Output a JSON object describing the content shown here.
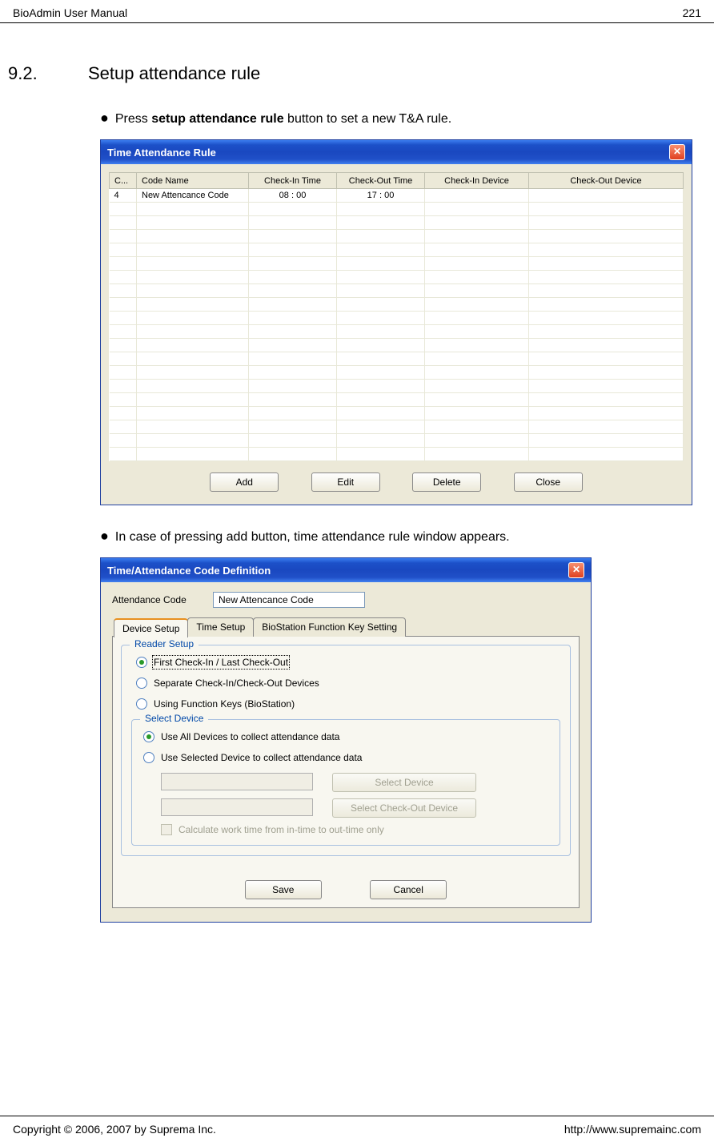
{
  "header": {
    "left": "BioAdmin User Manual",
    "page_num": "221"
  },
  "section": {
    "number": "9.2.",
    "title": "Setup attendance rule"
  },
  "bullets": {
    "b1_prefix": "Press ",
    "b1_bold": "setup attendance rule",
    "b1_suffix": " button to set a new T&A rule.",
    "b2": "In case of pressing add button, time attendance rule window appears."
  },
  "win1": {
    "title": "Time Attendance Rule",
    "cols": [
      "C...",
      "Code Name",
      "Check-In Time",
      "Check-Out Time",
      "Check-In Device",
      "Check-Out Device"
    ],
    "rows": [
      {
        "c": "4",
        "name": "New Attencance Code",
        "in": "08 : 00",
        "out": "17 : 00",
        "ind": "",
        "outd": ""
      }
    ],
    "buttons": {
      "add": "Add",
      "edit": "Edit",
      "del": "Delete",
      "close": "Close"
    }
  },
  "win2": {
    "title": "Time/Attendance Code Definition",
    "attendance_code_label": "Attendance Code",
    "attendance_code_value": "New Attencance Code",
    "tabs": {
      "t1": "Device Setup",
      "t2": "Time Setup",
      "t3": "BioStation Function Key Setting"
    },
    "reader_setup": {
      "legend": "Reader Setup",
      "r1": "First Check-In / Last Check-Out",
      "r2": "Separate Check-In/Check-Out Devices",
      "r3": "Using Function Keys (BioStation)"
    },
    "select_device": {
      "legend": "Select Device",
      "r1": "Use All Devices to collect attendance data",
      "r2": "Use Selected Device to collect attendance data",
      "btn1": "Select Device",
      "btn2": "Select Check-Out Device",
      "chk": "Calculate work time from in-time to out-time only"
    },
    "buttons": {
      "save": "Save",
      "cancel": "Cancel"
    }
  },
  "footer": {
    "copyright": "Copyright © 2006, 2007 by Suprema Inc.",
    "url": "http://www.supremainc.com"
  }
}
